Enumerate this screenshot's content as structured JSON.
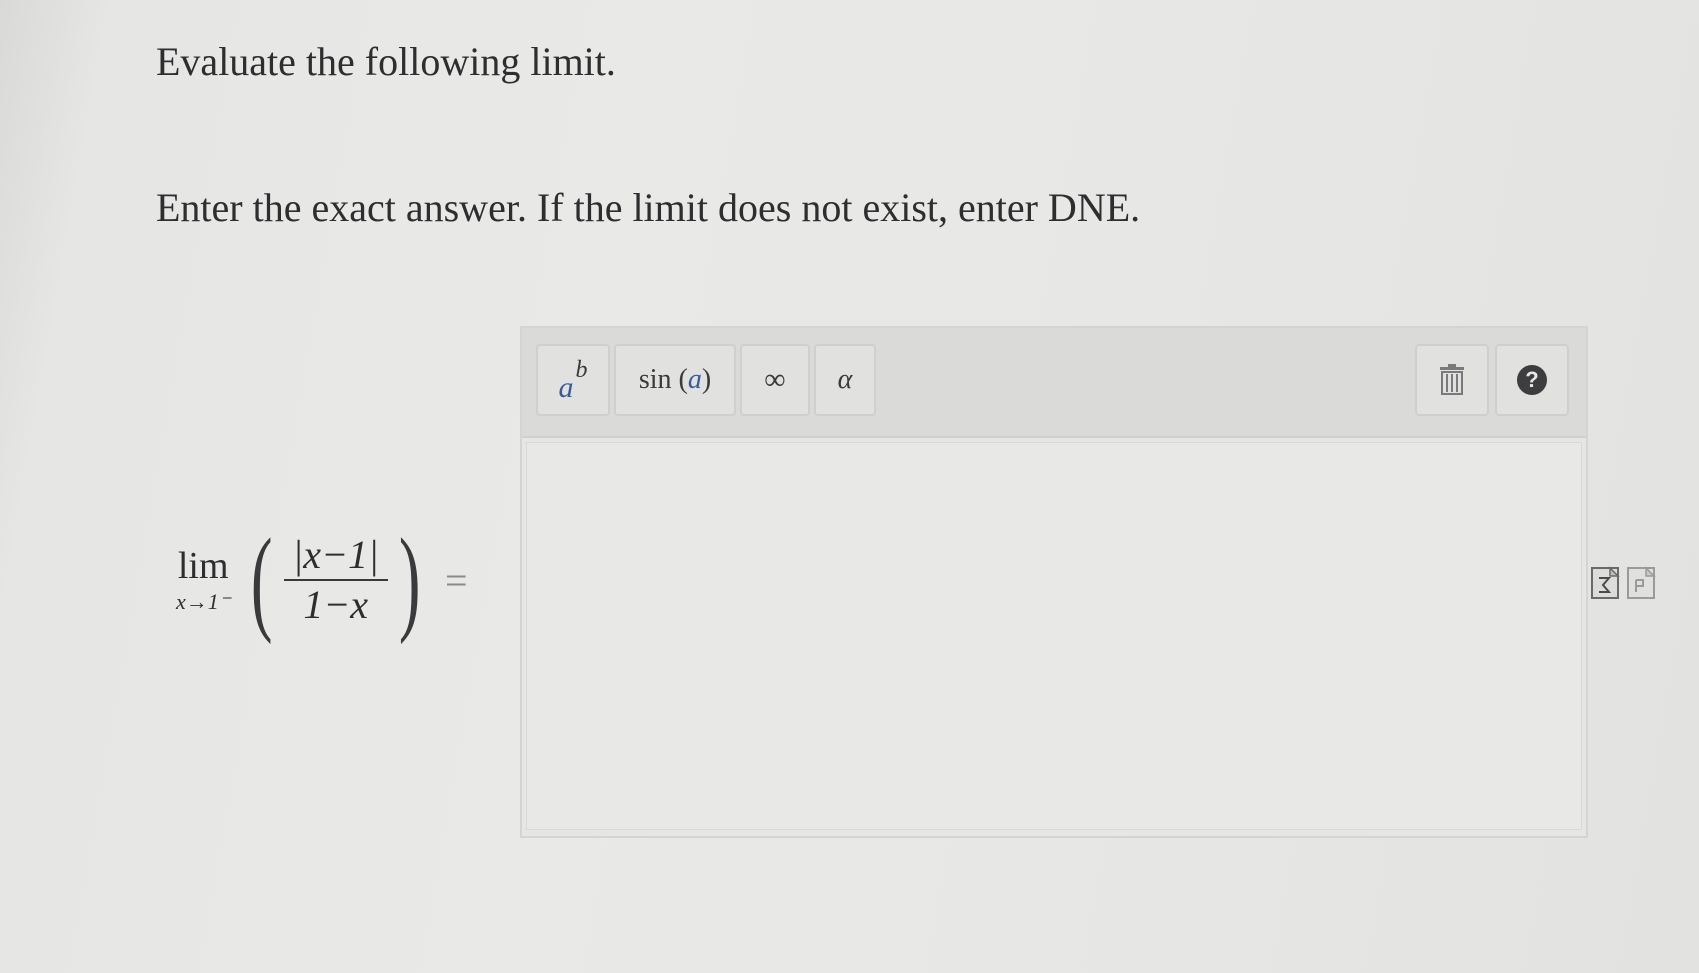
{
  "question": {
    "title": "Evaluate the following limit.",
    "instructions": "Enter the exact answer. If the limit does not exist, enter DNE."
  },
  "expression": {
    "lim_word": "lim",
    "subscript": "x→1⁻",
    "numerator": "|x−1|",
    "denominator": "1−x",
    "open_paren": "(",
    "close_paren": ")",
    "equals": "="
  },
  "toolbar": {
    "power": {
      "base": "a",
      "exponent": "b"
    },
    "sin": {
      "func": "sin",
      "open": " (",
      "arg": "a",
      "close": ")"
    },
    "infinity_label": "∞",
    "alpha_label": "α",
    "trash_icon": "trash-icon",
    "help_label": "?"
  },
  "answer": {
    "value": ""
  },
  "side_icons": [
    "equation-editor-icon",
    "document-icon"
  ],
  "colors": {
    "background": "#e7e7e5",
    "toolbar": "#dadad8",
    "accent_variable": "#3a5a9c",
    "text": "#2e2e30"
  }
}
